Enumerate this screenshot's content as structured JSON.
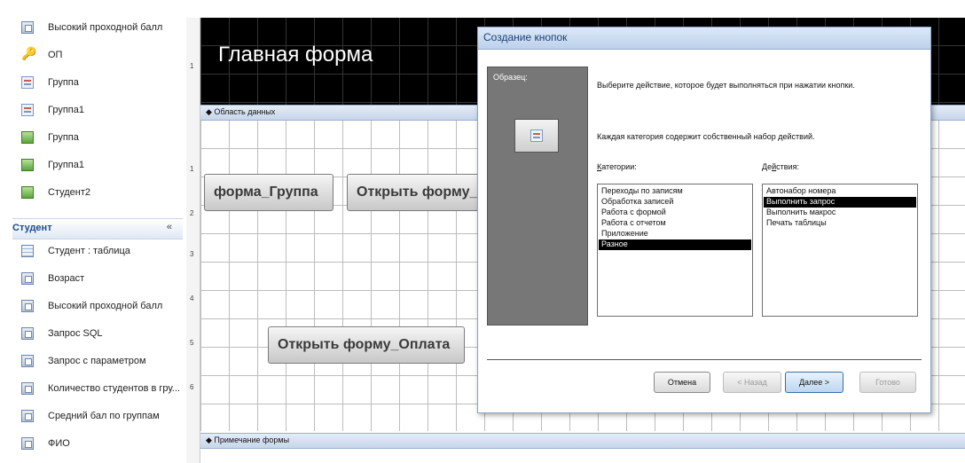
{
  "nav": {
    "items_top": [
      {
        "label": "Высокий проходной балл",
        "icon": "query-icon"
      },
      {
        "label": "ОП",
        "icon": "key-icon"
      },
      {
        "label": "Группа",
        "icon": "form-icon"
      },
      {
        "label": "Группа1",
        "icon": "form-icon"
      },
      {
        "label": "Группа",
        "icon": "report-icon"
      },
      {
        "label": "Группа1",
        "icon": "report-icon"
      },
      {
        "label": "Студент2",
        "icon": "report-icon"
      }
    ],
    "group": {
      "title": "Студент",
      "chevron": "«"
    },
    "items_group": [
      {
        "label": "Студент : таблица",
        "icon": "table-icon"
      },
      {
        "label": "Возраст",
        "icon": "query-icon"
      },
      {
        "label": "Высокий проходной балл",
        "icon": "query-icon"
      },
      {
        "label": "Запрос SQL",
        "icon": "query-icon"
      },
      {
        "label": "Запрос с параметром",
        "icon": "query-icon"
      },
      {
        "label": "Количество студентов в гру...",
        "icon": "query-icon"
      },
      {
        "label": "Средний бал по группам",
        "icon": "query-icon"
      },
      {
        "label": "ФИО",
        "icon": "query-icon"
      }
    ]
  },
  "designer": {
    "header_title": "Главная форма",
    "detail_bar": "◆ Область данных",
    "footer_bar": "◆ Примечание формы",
    "ruler_numbers": [
      "1",
      "1",
      "2",
      "3",
      "4",
      "5",
      "6"
    ],
    "buttons": [
      "форма_Группа",
      "Открыть форму_С",
      "Открыть форму_Оплата"
    ]
  },
  "dialog": {
    "title": "Создание кнопок",
    "sample_label": "Образец:",
    "instruction": "Выберите действие, которое будет выполняться при нажатии кнопки.",
    "category_note": "Каждая категория содержит собственный набор действий.",
    "categories_label": "Категории:",
    "actions_label": "Действия:",
    "categories": [
      "Переходы по записям",
      "Обработка записей",
      "Работа с формой",
      "Работа с отчетом",
      "Приложение",
      "Разное"
    ],
    "categories_selected": 5,
    "actions": [
      "Автонабор номера",
      "Выполнить запрос",
      "Выполнить макрос",
      "Печать таблицы"
    ],
    "actions_selected": 1,
    "buttons": {
      "cancel": "Отмена",
      "back": "< Назад",
      "next": "Далее >",
      "finish": "Готово"
    }
  }
}
